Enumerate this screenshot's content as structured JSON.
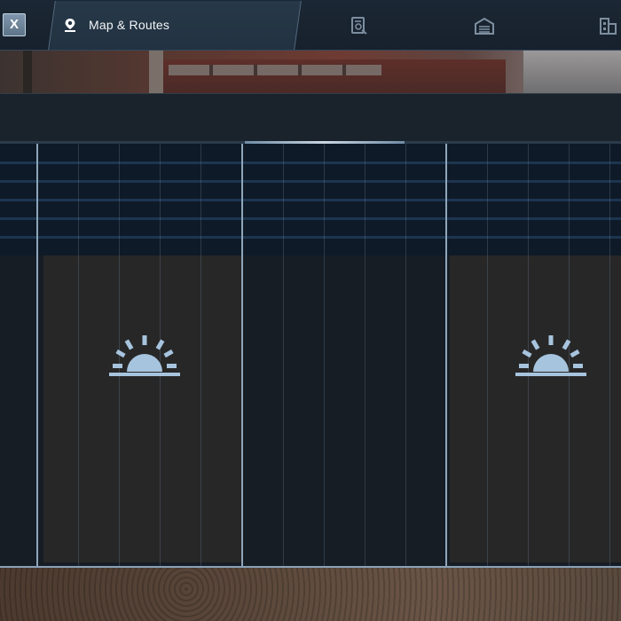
{
  "topbar": {
    "close_label": "X",
    "active_tab": {
      "label": "Map & Routes",
      "icon": "map-pin-icon"
    },
    "other_tabs": [
      {
        "icon": "contract-document-icon"
      },
      {
        "icon": "garage-icon"
      },
      {
        "icon": "buildings-icon"
      }
    ]
  },
  "schedule": {
    "day_icon": "sunrise-icon"
  },
  "colors": {
    "accent": "#8fa6bb",
    "sun_icon": "#a7c4de",
    "grid_top": "#0e1a27",
    "day_column": "#272727"
  }
}
